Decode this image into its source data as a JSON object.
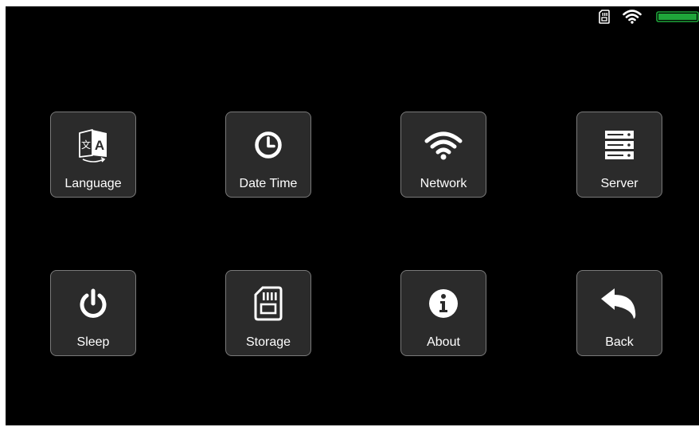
{
  "status_bar": {
    "icons": [
      "sd-card-icon",
      "wifi-icon",
      "battery-icon"
    ],
    "battery_color": "#1fa53a"
  },
  "menu": {
    "items": [
      {
        "label": "Language",
        "icon": "language-icon"
      },
      {
        "label": "Date Time",
        "icon": "clock-icon"
      },
      {
        "label": "Network",
        "icon": "wifi-icon"
      },
      {
        "label": "Server",
        "icon": "server-icon"
      },
      {
        "label": "Sleep",
        "icon": "power-icon"
      },
      {
        "label": "Storage",
        "icon": "sd-card-icon"
      },
      {
        "label": "About",
        "icon": "info-icon"
      },
      {
        "label": "Back",
        "icon": "back-arrow-icon"
      }
    ]
  },
  "colors": {
    "background": "#000000",
    "tile_background": "#2b2b2b",
    "tile_border": "#7a7a7a",
    "text": "#ffffff"
  }
}
